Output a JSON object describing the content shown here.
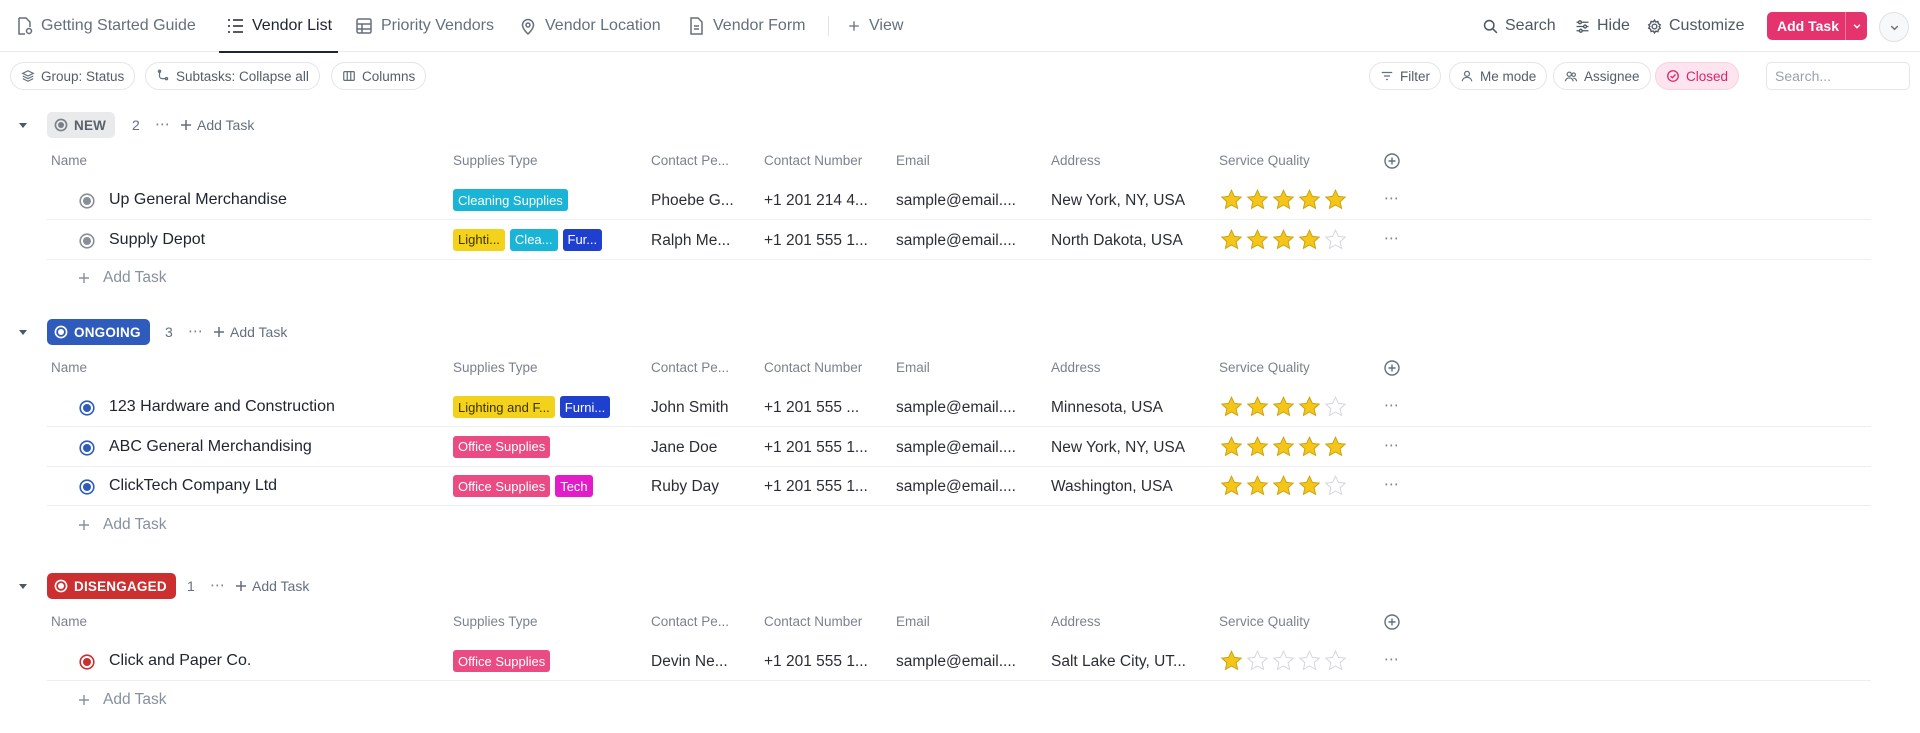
{
  "tabs": [
    {
      "label": "Getting Started Guide",
      "icon": "doc-settings-icon"
    },
    {
      "label": "Vendor List",
      "icon": "list-icon",
      "active": true
    },
    {
      "label": "Priority Vendors",
      "icon": "table-icon"
    },
    {
      "label": "Vendor Location",
      "icon": "map-pin-icon"
    },
    {
      "label": "Vendor Form",
      "icon": "form-icon"
    },
    {
      "label": "View",
      "icon": "plus-icon"
    }
  ],
  "toolbar": {
    "search_label": "Search",
    "hide_label": "Hide",
    "customize_label": "Customize",
    "add_task_label": "Add Task"
  },
  "filters": {
    "group": "Group: Status",
    "subtasks": "Subtasks: Collapse all",
    "columns": "Columns",
    "filter": "Filter",
    "me_mode": "Me mode",
    "assignee": "Assignee",
    "closed": "Closed",
    "search_placeholder": "Search..."
  },
  "columns": {
    "name": "Name",
    "supplies": "Supplies Type",
    "contact_person": "Contact Pe...",
    "contact_number": "Contact Number",
    "email": "Email",
    "address": "Address",
    "quality": "Service Quality"
  },
  "add_task_label": "Add Task",
  "colors": {
    "new": "#8a8f97",
    "ongoing": "#2f5bbd",
    "disengaged": "#cc2f2f",
    "accent": "#e5336e",
    "star": "#f5c518"
  },
  "groups": [
    {
      "status": "NEW",
      "count": "2",
      "tasks": [
        {
          "name": "Up General Merchandise",
          "tags": [
            "Cleaning Supplies"
          ],
          "contact": "Phoebe G...",
          "phone": "+1 201 214 4...",
          "email": "sample@email....",
          "address": "New York, NY, USA",
          "rating": 5
        },
        {
          "name": "Supply Depot",
          "tags": [
            "Lighti...",
            "Clea...",
            "Fur..."
          ],
          "contact": "Ralph Me...",
          "phone": "+1 201 555 1...",
          "email": "sample@email....",
          "address": "North Dakota, USA",
          "rating": 4
        }
      ]
    },
    {
      "status": "ONGOING",
      "count": "3",
      "tasks": [
        {
          "name": "123 Hardware and Construction",
          "tags": [
            "Lighting and F...",
            "Furni..."
          ],
          "contact": "John Smith",
          "phone": "+1 201 555 ...",
          "email": "sample@email....",
          "address": "Minnesota, USA",
          "rating": 4
        },
        {
          "name": "ABC General Merchandising",
          "tags": [
            "Office Supplies"
          ],
          "contact": "Jane Doe",
          "phone": "+1 201 555 1...",
          "email": "sample@email....",
          "address": "New York, NY, USA",
          "rating": 5
        },
        {
          "name": "ClickTech Company Ltd",
          "tags": [
            "Office Supplies",
            "Tech"
          ],
          "contact": "Ruby Day",
          "phone": "+1 201 555 1...",
          "email": "sample@email....",
          "address": "Washington, USA",
          "rating": 4
        }
      ]
    },
    {
      "status": "DISENGAGED",
      "count": "1",
      "tasks": [
        {
          "name": "Click and Paper Co.",
          "tags": [
            "Office Supplies"
          ],
          "contact": "Devin Ne...",
          "phone": "+1 201 555 1...",
          "email": "sample@email....",
          "address": "Salt Lake City, UT...",
          "rating": 1
        }
      ]
    }
  ]
}
